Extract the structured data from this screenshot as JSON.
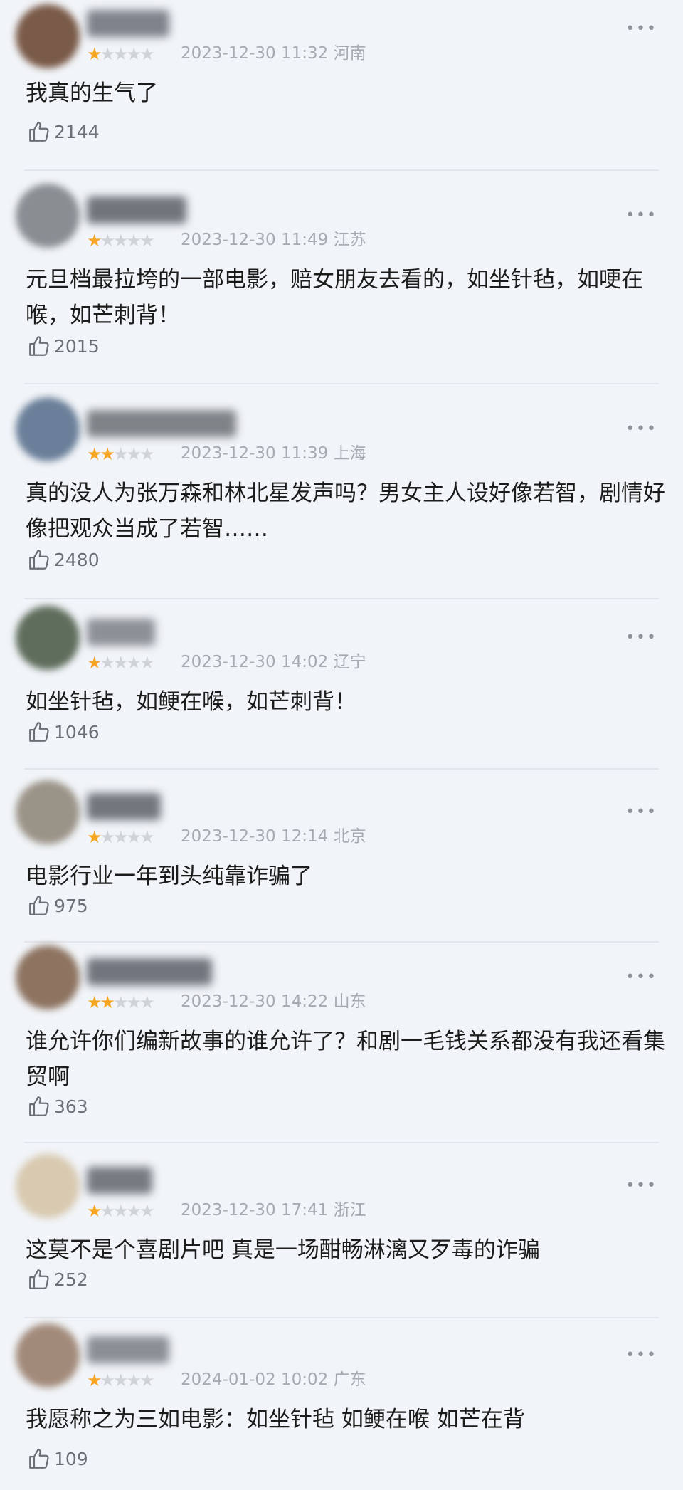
{
  "comments": [
    {
      "rating": 1,
      "time": "2023-12-30 11:32",
      "location": "河南",
      "text": "我真的生气了",
      "likes": "2144",
      "avatar_color": "#7a5a48",
      "name_color": "#6a6f78"
    },
    {
      "rating": 1,
      "time": "2023-12-30 11:49",
      "location": "江苏",
      "text": "元旦档最拉垮的一部电影，赔女朋友去看的，如坐针毡，如哽在喉，如芒刺背！",
      "likes": "2015",
      "avatar_color": "#8a8e93",
      "name_color": "#5a5f66"
    },
    {
      "rating": 2,
      "time": "2023-12-30 11:39",
      "location": "上海",
      "text": "真的没人为张万森和林北星发声吗？男女主人设好像若智，剧情好像把观众当成了若智……",
      "likes": "2480",
      "avatar_color": "#6a7f99",
      "name_color": "#6c7075"
    },
    {
      "rating": 1,
      "time": "2023-12-30 14:02",
      "location": "辽宁",
      "text": "如坐针毡，如鲠在喉，如芒刺背！",
      "likes": "1046",
      "avatar_color": "#5f6d5c",
      "name_color": "#7c8087"
    },
    {
      "rating": 1,
      "time": "2023-12-30 12:14",
      "location": "北京",
      "text": "电影行业一年到头纯靠诈骗了",
      "likes": "975",
      "avatar_color": "#9a9387",
      "name_color": "#5d6168"
    },
    {
      "rating": 2,
      "time": "2023-12-30 14:22",
      "location": "山东",
      "text": "谁允许你们编新故事的谁允许了？和剧一毛钱关系都没有我还看集贸啊",
      "likes": "363",
      "avatar_color": "#8d7360",
      "name_color": "#5b6068"
    },
    {
      "rating": 1,
      "time": "2023-12-30 17:41",
      "location": "浙江",
      "text": "这莫不是个喜剧片吧  真是一场酣畅淋漓又歹毒的诈骗",
      "likes": "252",
      "avatar_color": "#d8c9b0",
      "name_color": "#62666d"
    },
    {
      "rating": 1,
      "time": "2024-01-02 10:02",
      "location": "广东",
      "text": "我愿称之为三如电影：如坐针毡 如鲠在喉 如芒在背",
      "likes": "109",
      "avatar_color": "#a28a7a",
      "name_color": "#7a7e85"
    }
  ],
  "colors": {
    "star_on": "#f5a623",
    "star_off": "#d0d3d8",
    "meta": "#a7abb1",
    "background": "#f1f4f8"
  },
  "icons": {
    "like": "thumbs-up-icon",
    "more": "more-dots-icon"
  }
}
